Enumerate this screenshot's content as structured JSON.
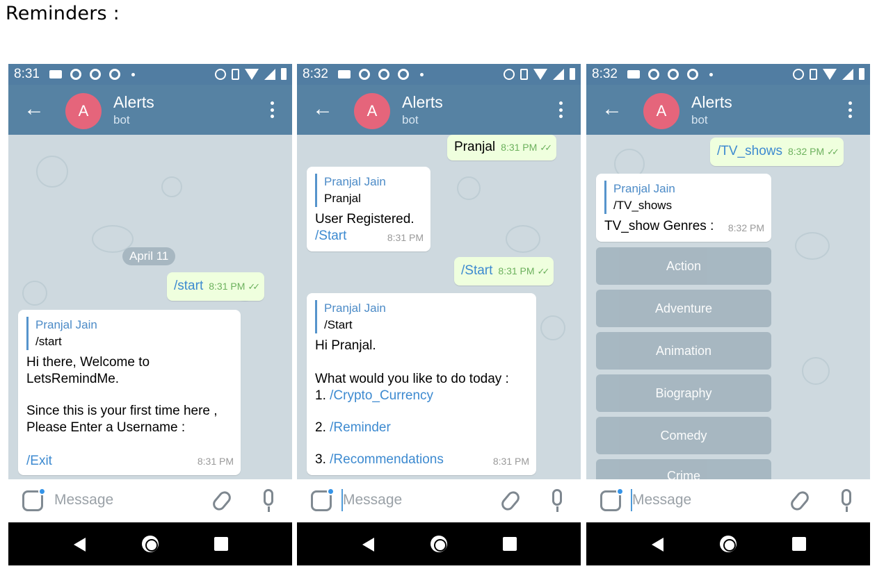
{
  "page_heading": "Reminders :",
  "colors": {
    "header": "#5682a3",
    "statusbar": "#517da2",
    "avatar": "#e5657b",
    "out_bubble": "#efffde",
    "link": "#3d8ad0",
    "chat_bg": "#ced9df"
  },
  "common": {
    "chat_title": "Alerts",
    "chat_subtitle": "bot",
    "avatar_letter": "A",
    "input_placeholder": "Message",
    "quote_name": "Pranjal Jain",
    "ticks": "✓✓"
  },
  "phones": [
    {
      "time": "8:31",
      "date_pill": "April 11",
      "out1": {
        "text": "/start",
        "time": "8:31 PM"
      },
      "in1": {
        "quote_text": "/start",
        "line1": "Hi there, Welcome to",
        "line2": "LetsRemindMe.",
        "line3": "Since this is your first time here ,",
        "line4": "Please Enter a Username :",
        "link": "/Exit",
        "time": "8:31 PM"
      }
    },
    {
      "time": "8:32",
      "out1": {
        "text": "Pranjal",
        "time": "8:31 PM"
      },
      "in1": {
        "quote_text": "Pranjal",
        "line1": "User Registered.",
        "link": "/Start",
        "time": "8:31 PM"
      },
      "out2": {
        "text": "/Start",
        "time": "8:31 PM"
      },
      "in2": {
        "quote_text": "/Start",
        "line1": "Hi Pranjal.",
        "line2": "What would you like to do today :",
        "item1_num": "1.",
        "item1_link": "/Crypto_Currency",
        "item2_num": "2.",
        "item2_link": "/Reminder",
        "item3_num": "3.",
        "item3_link": "/Recommendations",
        "time": "8:31 PM"
      }
    },
    {
      "time": "8:32",
      "out1": {
        "text": "/TV_shows",
        "time": "8:32 PM"
      },
      "in1": {
        "quote_text": "/TV_shows",
        "line1": "TV_show Genres :",
        "time": "8:32 PM"
      },
      "keyboard": [
        "Action",
        "Adventure",
        "Animation",
        "Biography",
        "Comedy",
        "Crime"
      ]
    }
  ]
}
